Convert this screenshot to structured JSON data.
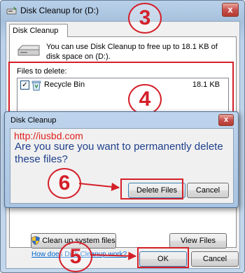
{
  "window": {
    "title": "Disk Cleanup for  (D:)",
    "close_glyph": "x",
    "tab_label": "Disk Cleanup",
    "intro_text": "You can use Disk Cleanup to free up to 18.1 KB of disk space on  (D:).",
    "files_to_delete_label": "Files to delete:",
    "files": [
      {
        "name": "Recycle Bin",
        "size": "18.1 KB",
        "checked": true
      }
    ],
    "cleanup_system_files_label": "Clean up system files",
    "view_files_label": "View Files",
    "help_link": "How does Disk Cleanup work?",
    "ok_label": "OK",
    "cancel_label": "Cancel"
  },
  "dialog": {
    "title": "Disk Cleanup",
    "close_glyph": "x",
    "watermark": "http://iusbd.com",
    "question": "Are you sure you want to permanently delete these files?",
    "delete_label": "Delete Files",
    "cancel_label": "Cancel"
  },
  "annotations": {
    "step_3": "3",
    "step_4": "4",
    "step_5": "5",
    "step_6": "6",
    "color": "#d4202a"
  },
  "icons": {
    "app": "disk-cleanup-icon",
    "drive": "drive-icon",
    "bin": "recycle-bin-icon",
    "shield": "uac-shield-icon",
    "check": "✓"
  }
}
